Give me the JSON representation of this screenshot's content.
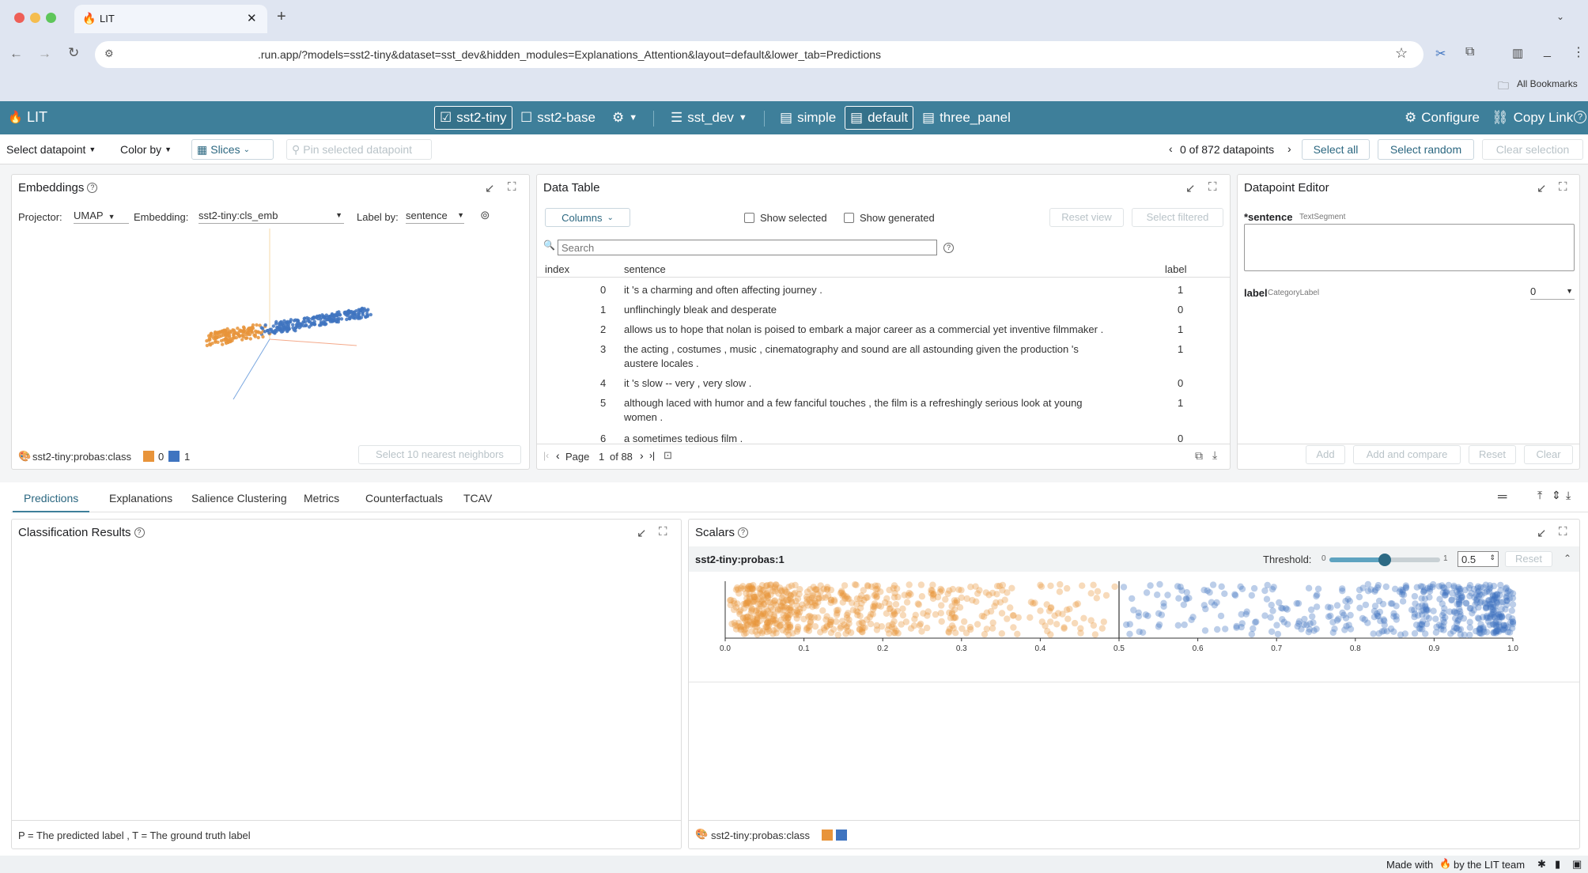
{
  "browser": {
    "tab_title": "LIT",
    "new_tab": "+",
    "url": ".run.app/?models=sst2-tiny&dataset=sst_dev&hidden_modules=Explanations_Attention&layout=default&lower_tab=Predictions",
    "bookmarks_label": "All Bookmarks"
  },
  "header": {
    "app_name": "LIT",
    "models": [
      {
        "label": "sst2-tiny",
        "selected": true
      },
      {
        "label": "sst2-base",
        "selected": false
      }
    ],
    "dataset": "sst_dev",
    "layouts": [
      {
        "label": "simple",
        "selected": false
      },
      {
        "label": "default",
        "selected": true
      },
      {
        "label": "three_panel",
        "selected": false
      }
    ],
    "configure": "Configure",
    "copy_link": "Copy Link"
  },
  "subbar": {
    "select_datapoint": "Select datapoint",
    "color_by": "Color by",
    "slices": "Slices",
    "pin": "Pin selected datapoint",
    "count": "0 of 872 datapoints",
    "select_all": "Select all",
    "select_random": "Select random",
    "clear_selection": "Clear selection"
  },
  "embeddings": {
    "title": "Embeddings",
    "projector_label": "Projector:",
    "projector_value": "UMAP",
    "embedding_label": "Embedding:",
    "embedding_value": "sst2-tiny:cls_emb",
    "labelby_label": "Label by:",
    "labelby_value": "sentence",
    "legend_name": "sst2-tiny:probas:class",
    "legend_0": "0",
    "legend_1": "1",
    "nearest": "Select 10 nearest neighbors"
  },
  "datatable": {
    "title": "Data Table",
    "columns_btn": "Columns",
    "show_selected": "Show selected",
    "show_generated": "Show generated",
    "reset_view": "Reset view",
    "select_filtered": "Select filtered",
    "search_placeholder": "Search",
    "headers": [
      "index",
      "sentence",
      "label"
    ],
    "rows": [
      {
        "index": "0",
        "sentence": "it 's a charming and often affecting journey .",
        "label": "1"
      },
      {
        "index": "1",
        "sentence": "unflinchingly bleak and desperate",
        "label": "0"
      },
      {
        "index": "2",
        "sentence": "allows us to hope that nolan is poised to embark a major career as a commercial yet inventive filmmaker .",
        "label": "1"
      },
      {
        "index": "3",
        "sentence": "the acting , costumes , music , cinematography and sound are all astounding given the production 's",
        "sentence2": "austere locales .",
        "label": "1"
      },
      {
        "index": "4",
        "sentence": "it 's slow -- very , very slow .",
        "label": "0"
      },
      {
        "index": "5",
        "sentence": "although laced with humor and a few fanciful touches , the film is a refreshingly serious look at young",
        "sentence2": "women .",
        "label": "1"
      },
      {
        "index": "6",
        "sentence": "a sometimes tedious film .",
        "label": "0"
      }
    ],
    "page_label": "Page",
    "page_num": "1",
    "page_of": "of 88"
  },
  "editor": {
    "title": "Datapoint Editor",
    "sentence_label": "*sentence",
    "sentence_type": "TextSegment",
    "label_label": "label",
    "label_type": "CategoryLabel",
    "label_value": "0",
    "add": "Add",
    "add_compare": "Add and compare",
    "reset": "Reset",
    "clear": "Clear"
  },
  "lower_tabs": [
    "Predictions",
    "Explanations",
    "Salience Clustering",
    "Metrics",
    "Counterfactuals",
    "TCAV"
  ],
  "classification": {
    "title": "Classification Results",
    "footer": "P = The predicted label , T = The ground truth label"
  },
  "scalars": {
    "title": "Scalars",
    "series": "sst2-tiny:probas:1",
    "threshold_label": "Threshold:",
    "slider_min": "0",
    "slider_max": "1",
    "threshold_value": "0.5",
    "reset": "Reset",
    "legend_name": "sst2-tiny:probas:class"
  },
  "footer": {
    "made_with": "Made with",
    "by": "by the LIT team"
  },
  "colors": {
    "class0": "#e8943a",
    "class1": "#3f74c0",
    "accent": "#3e7f9a"
  },
  "chart_data": {
    "type": "scatter",
    "xlim": [
      0.0,
      1.0
    ],
    "x_ticks": [
      "0.0",
      "0.1",
      "0.2",
      "0.3",
      "0.4",
      "0.5",
      "0.6",
      "0.7",
      "0.8",
      "0.9",
      "1.0"
    ],
    "threshold": 0.5,
    "series": [
      {
        "values": [
          0.02,
          0.03,
          0.04,
          0.05,
          0.06,
          0.07,
          0.08,
          0.1,
          0.12,
          0.14,
          0.16,
          0.18,
          0.2,
          0.22,
          0.25,
          0.28,
          0.3,
          0.33,
          0.36,
          0.4,
          0.42,
          0.45,
          0.48
        ]
      },
      {
        "values": [
          0.52,
          0.55,
          0.58,
          0.62,
          0.66,
          0.7,
          0.74,
          0.78,
          0.82,
          0.85,
          0.88,
          0.9,
          0.92,
          0.94,
          0.96,
          0.97,
          0.98,
          0.99
        ]
      }
    ]
  }
}
